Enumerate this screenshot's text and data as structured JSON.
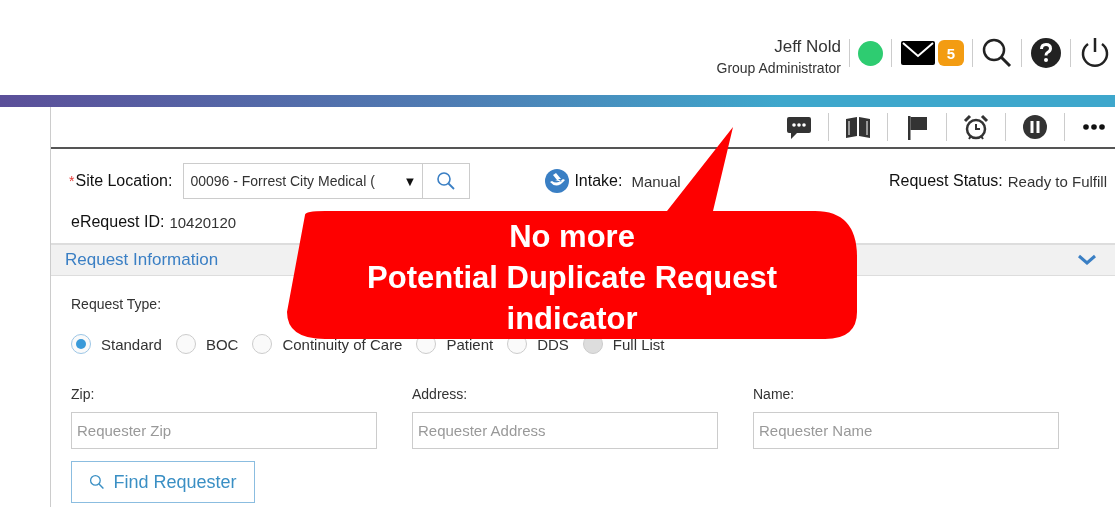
{
  "header": {
    "user_name": "Jeff Nold",
    "user_role": "Group Administrator",
    "online": true,
    "mail_count": "5"
  },
  "site_location": {
    "required_mark": "*",
    "label": "Site Location:",
    "value": "00096 - Forrest City Medical (",
    "arrow": "▼"
  },
  "intake": {
    "label": "Intake:",
    "value": "Manual"
  },
  "request_status": {
    "label": "Request Status:",
    "value": "Ready to Fulfill"
  },
  "erequest": {
    "label": "eRequest ID:",
    "value": "10420120"
  },
  "section": {
    "title": "Request Information",
    "expanded": true
  },
  "request_type": {
    "label": "Request Type:",
    "options": [
      {
        "label": "Standard",
        "selected": true,
        "disabled": false
      },
      {
        "label": "BOC",
        "selected": false,
        "disabled": false
      },
      {
        "label": "Continuity of Care",
        "selected": false,
        "disabled": false
      },
      {
        "label": "Patient",
        "selected": false,
        "disabled": false
      },
      {
        "label": "DDS",
        "selected": false,
        "disabled": false
      },
      {
        "label": "Full List",
        "selected": false,
        "disabled": true
      }
    ]
  },
  "fields": [
    {
      "label": "Zip:",
      "placeholder": "Requester Zip"
    },
    {
      "label": "Address:",
      "placeholder": "Requester Address"
    },
    {
      "label": "Name:",
      "placeholder": "Requester Name"
    }
  ],
  "find_button": "Find Requester",
  "callout": {
    "lines": [
      "No more",
      "Potential Duplicate Request",
      "indicator"
    ]
  }
}
